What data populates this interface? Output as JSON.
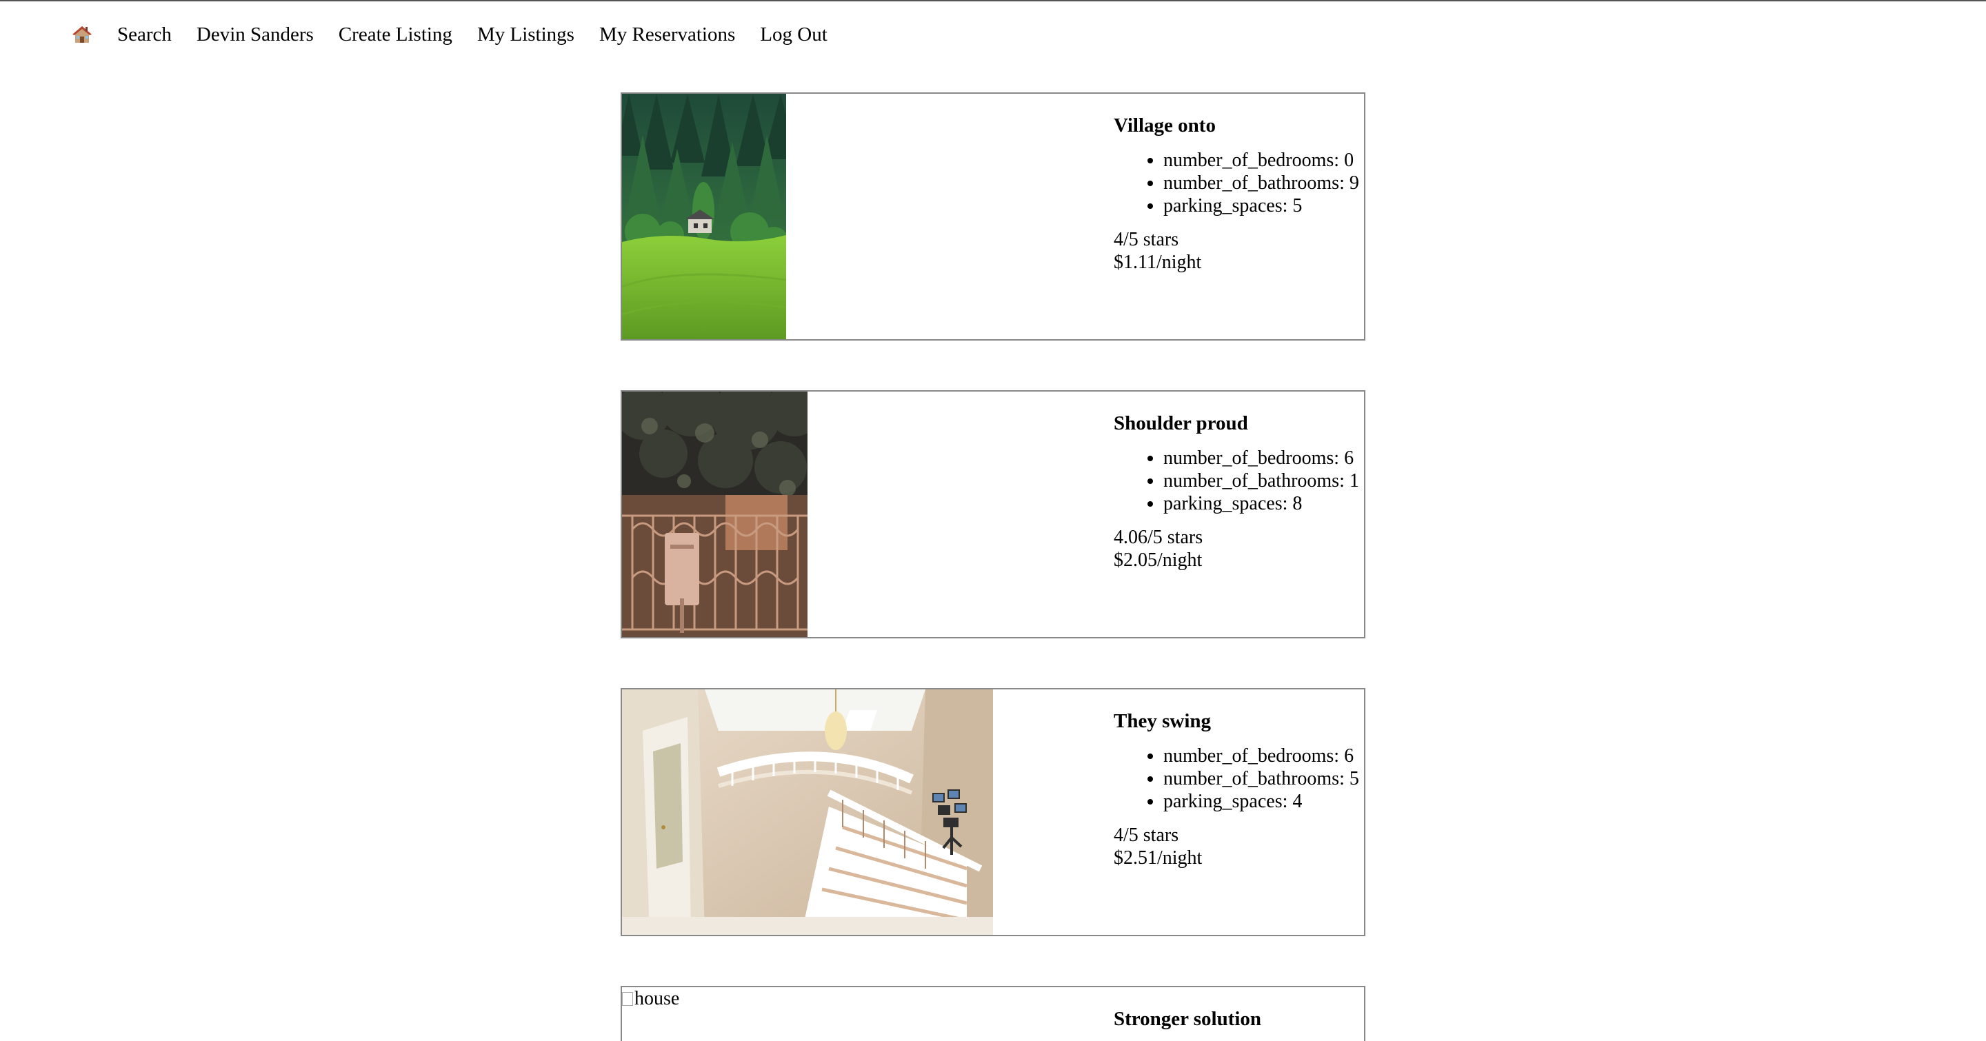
{
  "nav": {
    "home_icon": "house-emoji-icon",
    "items": [
      {
        "label": "Search"
      },
      {
        "label": "Devin Sanders"
      },
      {
        "label": "Create Listing"
      },
      {
        "label": "My Listings"
      },
      {
        "label": "My Reservations"
      },
      {
        "label": "Log Out"
      }
    ]
  },
  "listings": [
    {
      "title": "Village onto",
      "features": [
        "number_of_bedrooms: 0",
        "number_of_bathrooms: 9",
        "parking_spaces: 5"
      ],
      "stars": "4/5 stars",
      "price": "$1.11/night",
      "photo": "forest-house-photo"
    },
    {
      "title": "Shoulder proud",
      "features": [
        "number_of_bedrooms: 6",
        "number_of_bathrooms: 1",
        "parking_spaces: 8"
      ],
      "stars": "4.06/5 stars",
      "price": "$2.05/night",
      "photo": "gate-mailbox-photo"
    },
    {
      "title": "They swing",
      "features": [
        "number_of_bedrooms: 6",
        "number_of_bathrooms: 5",
        "parking_spaces: 4"
      ],
      "stars": "4/5 stars",
      "price": "$2.51/night",
      "photo": "staircase-interior-photo"
    },
    {
      "title": "Stronger solution",
      "image_alt": "house"
    }
  ]
}
